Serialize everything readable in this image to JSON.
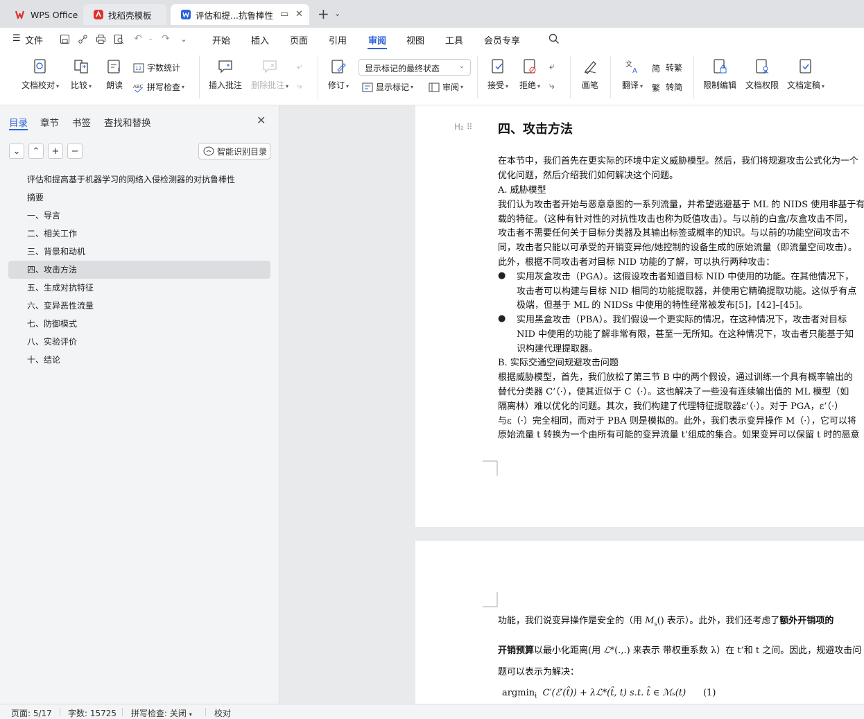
{
  "tabs": {
    "wps": "WPS Office",
    "template": "找稻壳模板",
    "document": "评估和提...抗鲁棒性"
  },
  "menu": {
    "file": "文件",
    "items": [
      "开始",
      "插入",
      "页面",
      "引用",
      "审阅",
      "视图",
      "工具",
      "会员专享"
    ],
    "active": "审阅"
  },
  "ribbon": {
    "doc_proofread": "文档校对",
    "compare": "比较",
    "read_aloud": "朗读",
    "word_count": "字数统计",
    "spell_check": "拼写检查",
    "insert_comment": "插入批注",
    "delete_comment": "删除批注",
    "revise": "修订",
    "markup_state": "显示标记的最终状态",
    "show_markup": "显示标记",
    "review": "审阅",
    "accept": "接受",
    "reject": "拒绝",
    "pen": "画笔",
    "translate": "翻译",
    "to_traditional": "转繁",
    "to_simplified": "转简",
    "restrict_edit": "限制编辑",
    "doc_permission": "文档权限",
    "doc_finalize": "文档定稿"
  },
  "nav": {
    "tabs": [
      "目录",
      "章节",
      "书签",
      "查找和替换"
    ],
    "smart_toc": "智能识别目录",
    "toc": [
      "评估和提高基于机器学习的网络入侵检测器的对抗鲁棒性",
      "摘要",
      "一、导言",
      "二、相关工作",
      "三、背景和动机",
      "四、攻击方法",
      "五、生成对抗特征",
      "六、变异恶性流量",
      "七、防御模式",
      "八、实验评价",
      "十、结论"
    ],
    "active_index": 5
  },
  "doc": {
    "heading": "四、攻击方法",
    "heading_marker": "H₂",
    "p1": "在本节中，我们首先在更实际的环境中定义威胁模型。然后，我们将规避攻击公式化为一个",
    "p2": "优化问题，然后介绍我们如何解决这个问题。",
    "sA": "A.  威胁模型",
    "p3": "我们认为攻击者开始与恶意意图的一系列流量，并希望逃避基于 ML 的 NIDS 使用非基于有",
    "p4": "载的特征。（这种有针对性的对抗性攻击也称为贬值攻击）。与以前的白盒/灰盒攻击不同，",
    "p5": "攻击者不需要任何关于目标分类器及其输出标签或概率的知识。与以前的功能空间攻击不",
    "p6": "同，攻击者只能以可承受的开销变异他/她控制的设备生成的原始流量（即流量空间攻击）。",
    "p7": "此外，根据不同攻击者对目标 NID 功能的了解，可以执行两种攻击：",
    "b1_1": "实用灰盒攻击（PGA）。这假设攻击者知道目标 NID 中使用的功能。在其他情况下，",
    "b1_2": "攻击者可以构建与目标 NID 相同的功能提取器，并使用它精确提取功能。这似乎有点",
    "b1_3": "极端，但基于 ML 的 NIDSs 中使用的特性经常被发布[5]，[42]–[45]。",
    "b2_1": "实用黑盒攻击（PBA）。我们假设一个更实际的情况，在这种情况下，攻击者对目标",
    "b2_2": "NID 中使用的功能了解非常有限，甚至一无所知。在这种情况下，攻击者只能基于知",
    "b2_3": "识构建代理提取器。",
    "sB": "B.  实际交通空间规避攻击问题",
    "p8": "根据威胁模型，首先，我们放松了第三节 B 中的两个假设，通过训练一个具有概率输出的",
    "p9": "替代分类器 C’（·），使其近似于 C（·）。这也解决了一些没有连续输出值的 ML 模型（如",
    "p10": "隔离林）难以优化的问题。其次，我们构建了代理特征提取器ε’（·）。对于 PGA，ε’（·）",
    "p11": "与ε（·）完全相同，而对于 PBA 则是模拟的。此外，我们表示变异操作 M（·），它可以将",
    "p12": "原始流量 t 转换为一个由所有可能的变异流量 t’组成的集合。如果变异可以保留 t 时的恶意",
    "q1a": "功能，我们说变异操作是安全的（用 ",
    "q1m": "M",
    "q1b": "() 表示）。此外，我们还考虑了",
    "q1c": "额外开销项的",
    "q2a": "开销预算",
    "q2b": "以最小化距离(用 ",
    "q2c": "(.,.) 来表示  带权重系数 λ）在 t’和 t 之间。因此，规避攻击问",
    "q3": "题可以表示为解决：",
    "eq_argmin": "argmin",
    "eq_body": "C′(ℰ′(t̂)) + λℒ*(t̂, t)    s.t.   t̂ ∈ ℳₛ(t)",
    "eq_num": "(1)"
  },
  "status": {
    "page": "页面: 5/17",
    "words": "字数: 15725",
    "spell": "拼写检查: 关闭",
    "proof": "校对"
  },
  "colors": {
    "accent": "#2b63d9",
    "wps_red": "#e0312a"
  }
}
